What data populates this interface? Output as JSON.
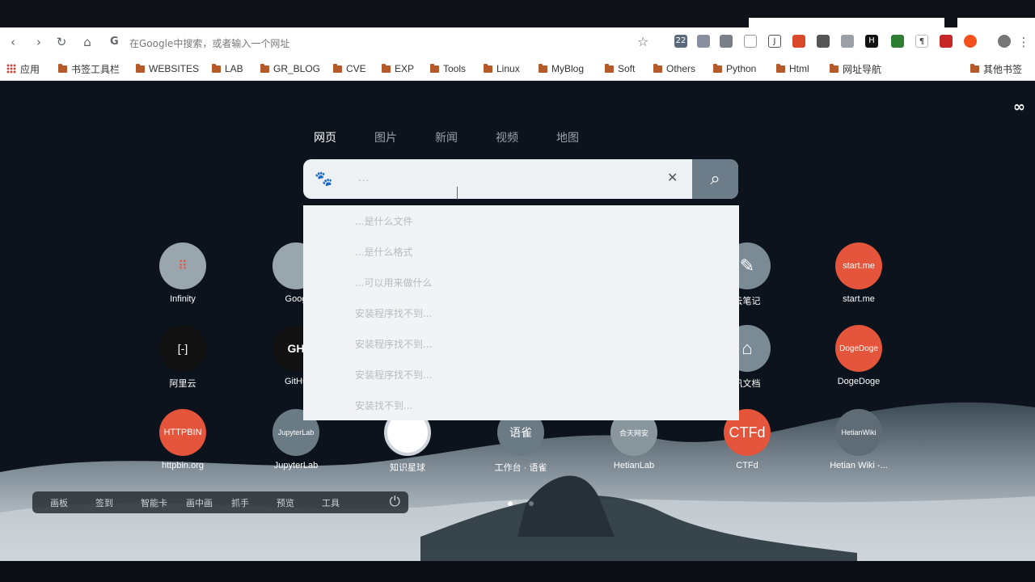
{
  "browser": {
    "omnibox_text": "在Google中搜索，或者输入一个网址",
    "bookmarks": [
      {
        "label": "应用",
        "icon": "apps-grid-icon"
      },
      {
        "label": "书签工具栏",
        "icon": "folder-icon"
      },
      {
        "label": "WEBSITES",
        "icon": "folder-icon"
      },
      {
        "label": "LAB",
        "icon": "folder-icon"
      },
      {
        "label": "GR_BLOG",
        "icon": "folder-icon"
      },
      {
        "label": "CVE",
        "icon": "folder-icon"
      },
      {
        "label": "EXP",
        "icon": "folder-icon"
      },
      {
        "label": "Tools",
        "icon": "folder-icon"
      },
      {
        "label": "Linux",
        "icon": "folder-icon"
      },
      {
        "label": "MyBlog",
        "icon": "folder-icon"
      },
      {
        "label": "Soft",
        "icon": "folder-icon"
      },
      {
        "label": "Others",
        "icon": "folder-icon"
      },
      {
        "label": "Python",
        "icon": "folder-icon"
      },
      {
        "label": "Html",
        "icon": "folder-icon"
      },
      {
        "label": "网址导航",
        "icon": "folder-icon"
      },
      {
        "label": "其他书签",
        "icon": "folder-icon"
      }
    ],
    "extension_badge": "22"
  },
  "newtab": {
    "corner_icon": "∞",
    "search_tabs": [
      "网页",
      "图片",
      "新闻",
      "视频",
      "地图"
    ],
    "active_tab": "网页",
    "search_value": "...",
    "suggestions": [
      "...是什么文件",
      "...是什么格式",
      "...可以用来做什么",
      "安装程序找不到...",
      "安装程序找不到...",
      "安装程序找不到...",
      "安装找不到..."
    ],
    "tiles": [
      {
        "label": "Infinity",
        "icon_text": "",
        "color": "#9aa6ae"
      },
      {
        "label": "Goog",
        "icon_text": "",
        "color": "#9aa6ae"
      },
      {
        "label": "云笔记",
        "icon_text": "✎",
        "color": "#7b8b96"
      },
      {
        "label": "start.me",
        "icon_text": "start.me",
        "color": "#e4553b"
      },
      {
        "label": "阿里云",
        "icon_text": "[-]",
        "color": "#111111"
      },
      {
        "label": "GitHu",
        "icon_text": "GH",
        "color": "#111111"
      },
      {
        "label": "讯文档",
        "icon_text": "⌂",
        "color": "#7b8b96"
      },
      {
        "label": "DogeDoge",
        "icon_text": "DogeDoge",
        "color": "#e4553b"
      },
      {
        "label": "httpbin.org",
        "icon_text": "HTTPBIN",
        "color": "#e4553b"
      },
      {
        "label": "JupyterLab",
        "icon_text": "JupyterLab",
        "color": "#6b7b86"
      },
      {
        "label": "知识星球",
        "icon_text": "",
        "color": "#ffffff"
      },
      {
        "label": "工作台 · 语雀",
        "icon_text": "语雀",
        "color": "#6b7b86"
      },
      {
        "label": "HetianLab",
        "icon_text": "合天网安",
        "color": "#8a969e"
      },
      {
        "label": "CTFd",
        "icon_text": "CTFd",
        "color": "#e4553b"
      },
      {
        "label": "Hetian Wiki -...",
        "icon_text": "HetianWiki",
        "color": "#5f6c76"
      }
    ],
    "dock": [
      "画板",
      "签到",
      "智能卡",
      "画中画",
      "抓手",
      "预览",
      "工具"
    ]
  }
}
